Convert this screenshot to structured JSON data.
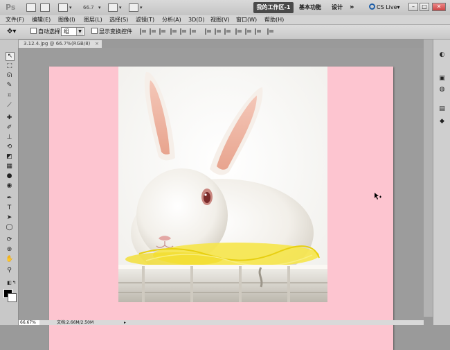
{
  "appbar": {
    "logo": "Ps",
    "zoom": "66.7",
    "workspace_active": "我的工作区-1",
    "workspace_basic": "基本功能",
    "workspace_design": "设计",
    "more": "»",
    "cs_live": "CS Live▾"
  },
  "menus": [
    "文件(F)",
    "编辑(E)",
    "图像(I)",
    "图层(L)",
    "选择(S)",
    "滤镜(T)",
    "分析(A)",
    "3D(D)",
    "视图(V)",
    "窗口(W)",
    "帮助(H)"
  ],
  "options": {
    "auto_select_label": "自动选择:",
    "group_value": "组",
    "show_transform_label": "显示变换控件"
  },
  "document": {
    "tab_title": "3.12.4.jpg @ 66.7%(RGB/8)",
    "tab_close": "×"
  },
  "status": {
    "zoom": "66.67%",
    "doc_info": "文档:2.66M/2.50M",
    "arrow": "▸"
  },
  "colors": {
    "canvas_background": "#fdc5d0",
    "workspace_active_bg": "#4a4a4a"
  }
}
